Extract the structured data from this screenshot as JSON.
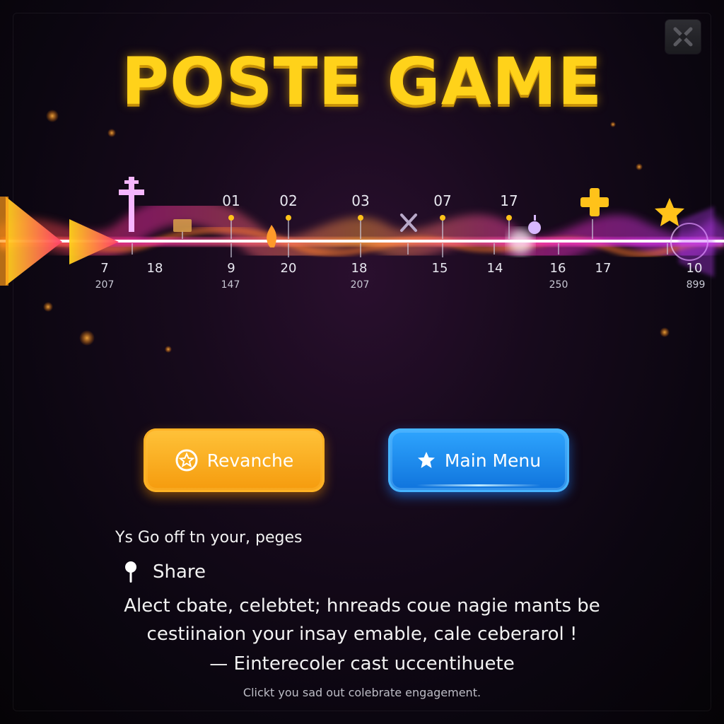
{
  "title": "POSTE GAME",
  "top_markers": [
    "01",
    "02",
    "03",
    "07",
    "17"
  ],
  "bottom_numbers": [
    "7",
    "18",
    "9",
    "20",
    "18",
    "15",
    "14",
    "16",
    "17",
    "10"
  ],
  "bottom_sub": [
    "207",
    "147",
    "207",
    "250",
    "899"
  ],
  "buttons": {
    "rematch": "Revanche",
    "main_menu": "Main Menu"
  },
  "share": {
    "prompt": "Ys Go off tn your, peges",
    "label": "Share"
  },
  "message": {
    "line1": "Alect cbate, celebtet; hnreads coue nagie mants be",
    "line2": "cestiinaion your insay emable, cale ceberarol !",
    "line3": "— Einterecoler cast uccentihuete",
    "footer": "Clickt you sad out colebrate engagement."
  },
  "colors": {
    "title": "#ffd21a",
    "track_glow": "#ff3fd0",
    "rematch_button": "#f7a51a",
    "menu_button": "#1a8cf0"
  }
}
